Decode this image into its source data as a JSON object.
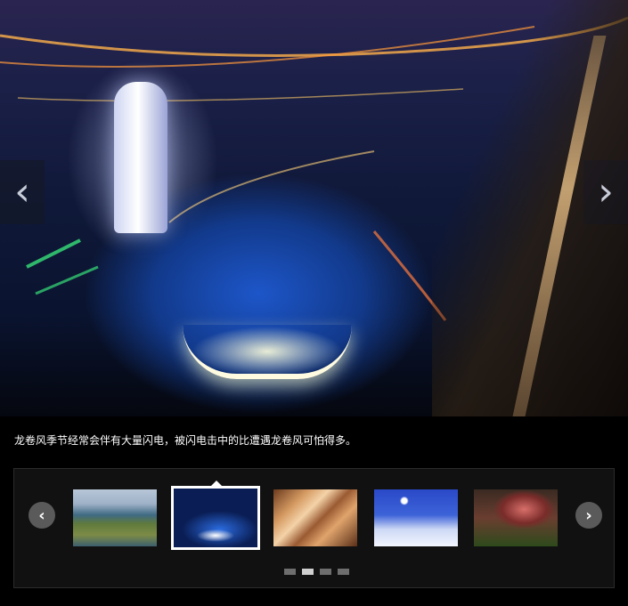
{
  "slideshow": {
    "caption": "龙卷风季节经常会伴有大量闪电，被闪电击中的比遭遇龙卷风可怕得多。",
    "prev_label": "‹",
    "next_label": "›",
    "current_index": 2,
    "total_slides": 5
  },
  "thumbnails": {
    "prev_label": "‹",
    "next_label": "›",
    "items": [
      {
        "subject": "aerial island landscape"
      },
      {
        "subject": "city night aerial"
      },
      {
        "subject": "canyon"
      },
      {
        "subject": "snow night moon"
      },
      {
        "subject": "cherry blossom tree"
      }
    ],
    "pages": 4,
    "active_page": 2
  },
  "colors": {
    "background": "#000000",
    "panel": "#111111",
    "active_dot": "#cfcfcf",
    "inactive_dot": "#6e6e6e",
    "active_border": "#ffffff"
  },
  "icons": {
    "hero_prev": "chevron-left-icon",
    "hero_next": "chevron-right-icon",
    "thumb_prev": "chevron-left-icon",
    "thumb_next": "chevron-right-icon"
  }
}
